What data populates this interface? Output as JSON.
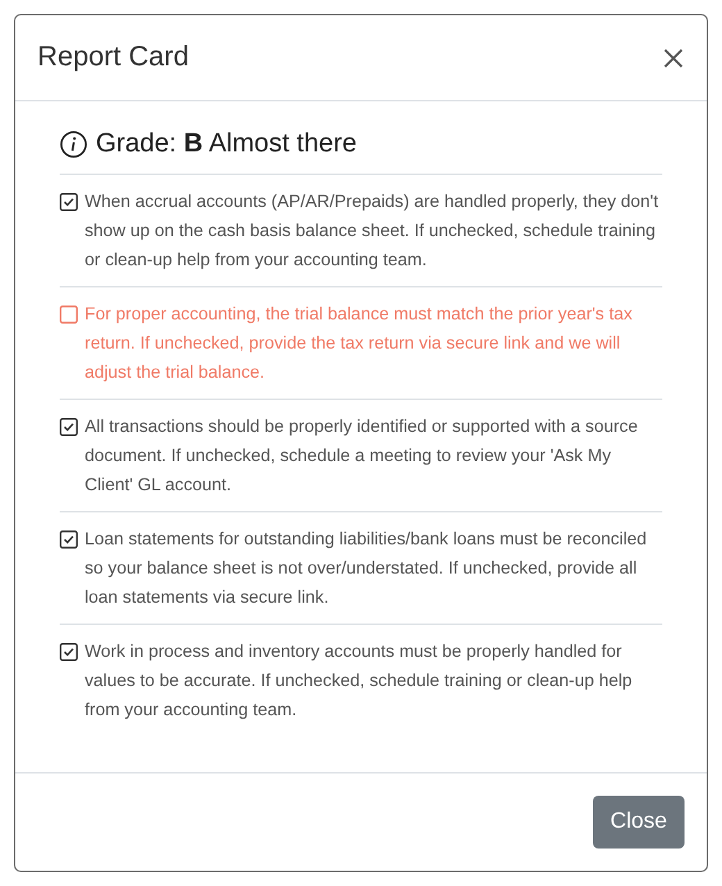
{
  "dialog": {
    "title": "Report Card",
    "close_label": "Close"
  },
  "grade": {
    "text": "Grade: **B** Almost there"
  },
  "items": [
    {
      "checked": true,
      "text": "When accrual accounts (AP/AR/Prepaids) are handled properly, they don't show up on the cash basis balance sheet. If unchecked, schedule training or clean-up help from your accounting team."
    },
    {
      "checked": false,
      "text": "For proper accounting, the trial balance must match the prior year's tax return. If unchecked, provide the tax return via secure link and we will adjust the trial balance."
    },
    {
      "checked": true,
      "text": "All transactions should be properly identified or supported with a source document. If unchecked, schedule a meeting to review your 'Ask My Client' GL account."
    },
    {
      "checked": true,
      "text": "Loan statements for outstanding liabilities/bank loans must be reconciled so your balance sheet is not over/understated. If unchecked, provide all loan statements via secure link."
    },
    {
      "checked": true,
      "text": "Work in process and inventory accounts must be properly handled for values to be accurate. If unchecked, schedule training or clean-up help from your accounting team."
    }
  ]
}
